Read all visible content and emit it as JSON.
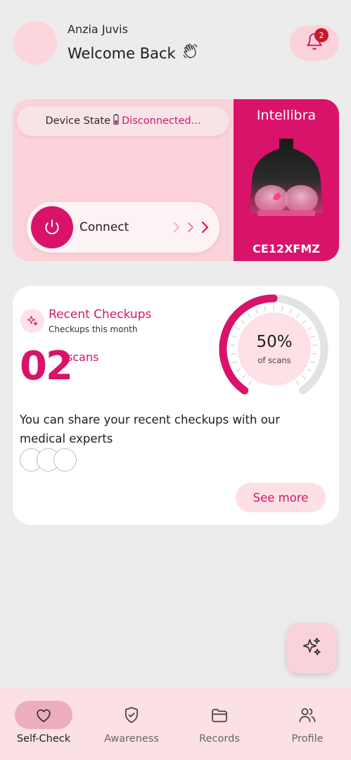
{
  "header": {
    "user_name": "Anzia Juvis",
    "welcome": "Welcome Back",
    "notification_count": "2",
    "icons": [
      "avatar",
      "waving-hand-icon",
      "bell-icon"
    ]
  },
  "device": {
    "state_label": "Device State",
    "state_value": "Disconnected...",
    "connect_label": "Connect",
    "device_name": "Intellibra",
    "device_code": "CE12XFMZ",
    "colors": {
      "accent": "#d9126a",
      "card_bg": "#fcd3da"
    }
  },
  "checkups": {
    "title": "Recent Checkups",
    "subtitle": "Checkups this month",
    "count": "02",
    "count_unit": "scans",
    "gauge_value": "50%",
    "gauge_unit": "of scans",
    "gauge_fraction": 0.5,
    "share_text": "You can share your recent checkups with our medical experts",
    "see_more_label": "See more"
  },
  "nav": {
    "items": [
      {
        "label": "Self-Check",
        "icon": "heart-icon",
        "active": true
      },
      {
        "label": "Awareness",
        "icon": "shield-check-icon",
        "active": false
      },
      {
        "label": "Records",
        "icon": "folder-icon",
        "active": false
      },
      {
        "label": "Profile",
        "icon": "users-icon",
        "active": false
      }
    ]
  }
}
